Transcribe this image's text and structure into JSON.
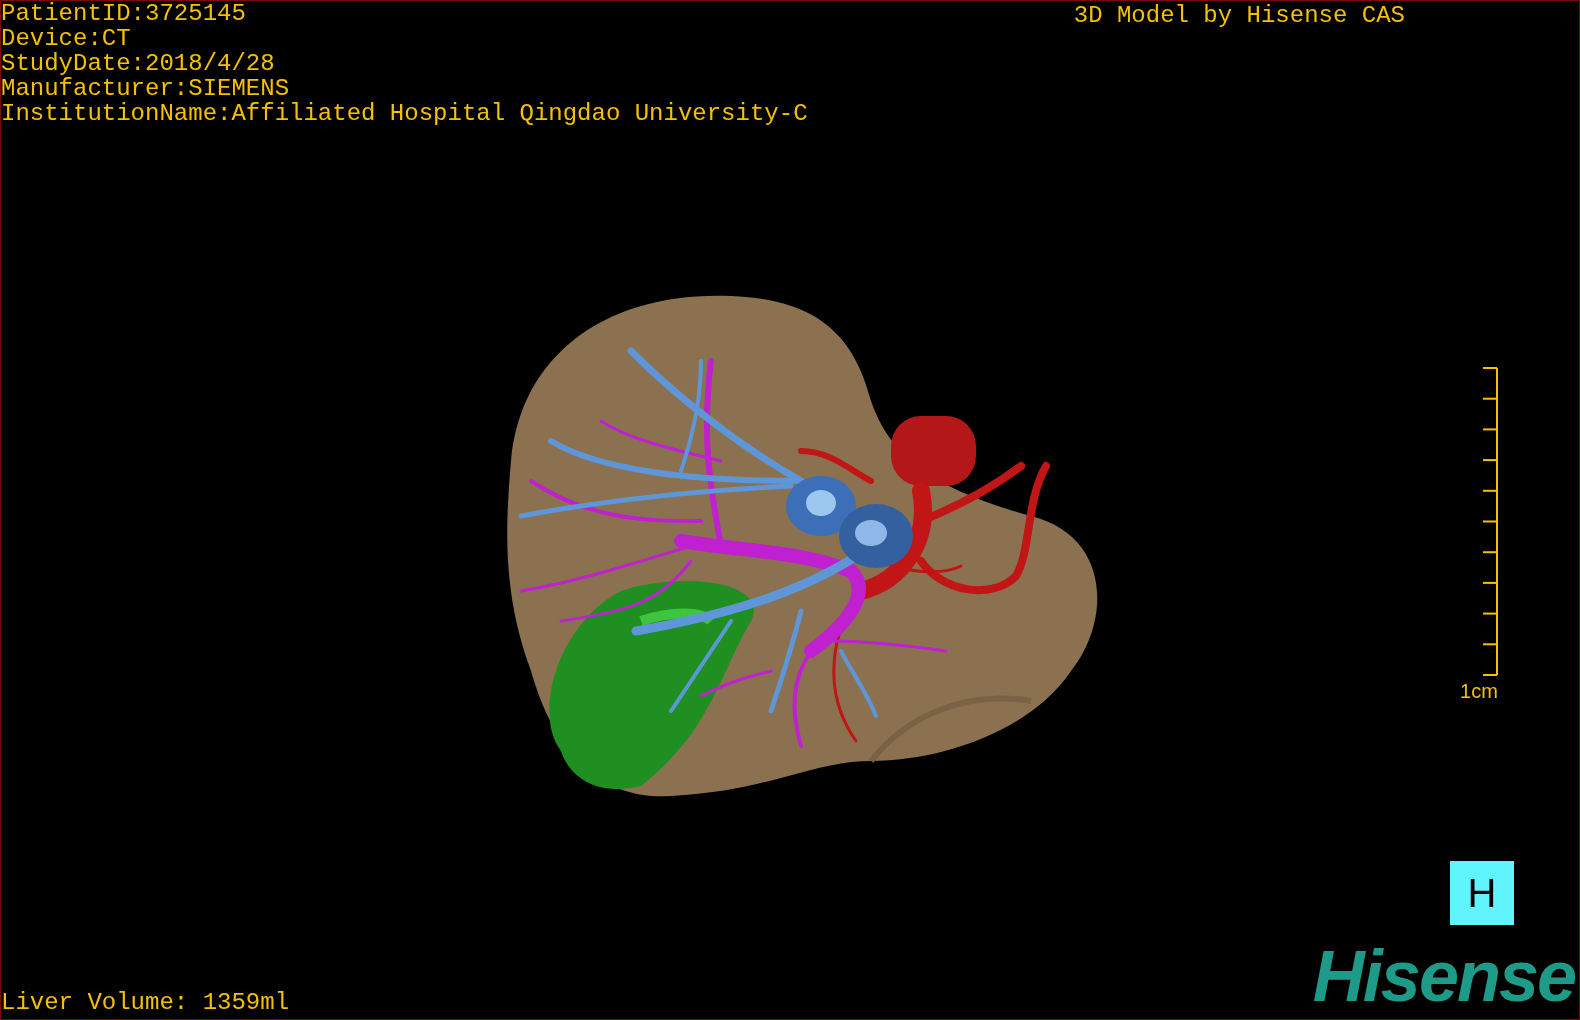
{
  "info_lines": [
    "PatientID:3725145",
    "Device:CT",
    "StudyDate:2018/4/28",
    "Manufacturer:SIEMENS",
    "InstitutionName:Affiliated Hospital Qingdao University-C"
  ],
  "model_credit": "3D Model by Hisense CAS",
  "scale_bar": {
    "label": "1cm"
  },
  "view_button": {
    "label": "H"
  },
  "liver_volume": "Liver Volume: 1359ml",
  "logo": "Hisense"
}
